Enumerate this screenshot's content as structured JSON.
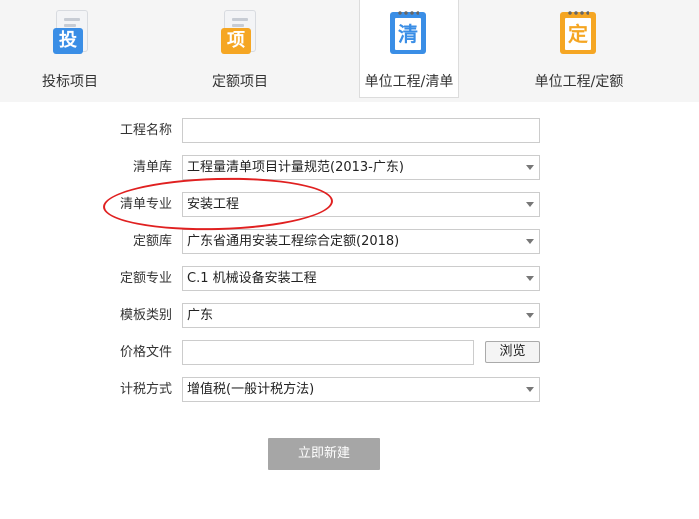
{
  "tabs": [
    {
      "label": "投标项目",
      "icon": "bid-doc-icon",
      "badge": "投",
      "color": "#3a8ee6",
      "active": false
    },
    {
      "label": "定额项目",
      "icon": "quota-doc-icon",
      "badge": "项",
      "color": "#f5a623",
      "active": false
    },
    {
      "label": "单位工程/清单",
      "icon": "bill-notebook-icon",
      "badge": "清",
      "color": "#3a8ee6",
      "active": true
    },
    {
      "label": "单位工程/定额",
      "icon": "quota-notebook-icon",
      "badge": "定",
      "color": "#f5a623",
      "active": false
    }
  ],
  "form": {
    "project_name": {
      "label": "工程名称",
      "value": ""
    },
    "bill_library": {
      "label": "清单库",
      "value": "工程量清单项目计量规范(2013-广东)"
    },
    "bill_specialty": {
      "label": "清单专业",
      "value": "安装工程"
    },
    "quota_library": {
      "label": "定额库",
      "value": "广东省通用安装工程综合定额(2018)"
    },
    "quota_specialty": {
      "label": "定额专业",
      "value": "C.1 机械设备安装工程"
    },
    "template_category": {
      "label": "模板类别",
      "value": "广东"
    },
    "price_file": {
      "label": "价格文件",
      "value": "",
      "browse_label": "浏览"
    },
    "tax_method": {
      "label": "计税方式",
      "value": "增值税(一般计税方法)"
    }
  },
  "submit_label": "立即新建",
  "colors": {
    "annotation": "#e02020",
    "submit_bg": "#a6a6a6",
    "blue": "#3a8ee6",
    "orange": "#f5a623"
  }
}
